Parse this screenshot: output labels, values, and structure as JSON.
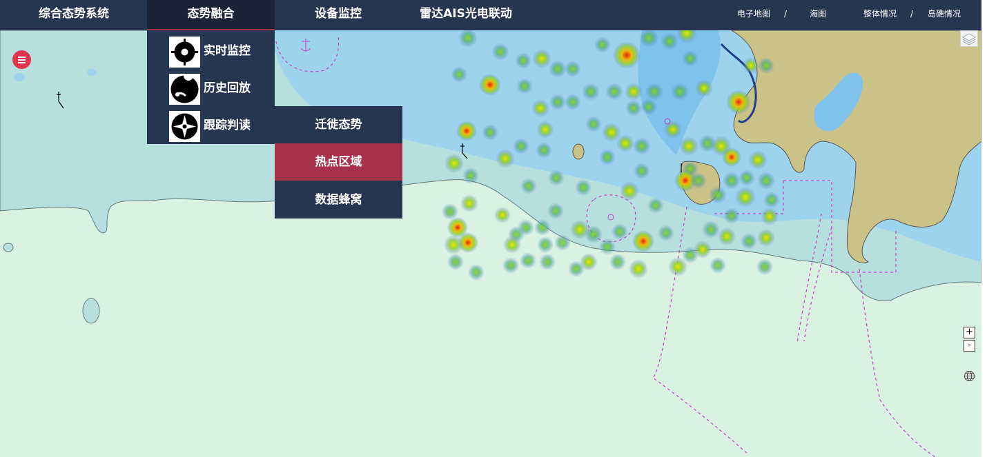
{
  "nav": {
    "brand": "综合态势系统",
    "items": [
      {
        "label": "态势融合"
      },
      {
        "label": "设备监控"
      },
      {
        "label": "雷达AIS光电联动"
      }
    ]
  },
  "right_links": {
    "link1": "电子地图",
    "sep1": "/",
    "link2": "海图",
    "link3": "整体情况",
    "sep2": "/",
    "link4": "岛礁情况"
  },
  "dropdown": {
    "items": [
      {
        "label": "实时监控",
        "icon": "crosshair-compass-icon"
      },
      {
        "label": "历史回放",
        "icon": "replay-map-pin-icon"
      },
      {
        "label": "跟踪判读",
        "icon": "compass-rose-icon"
      }
    ]
  },
  "submenu": {
    "items": [
      {
        "label": "迁徙态势"
      },
      {
        "label": "热点区域"
      },
      {
        "label": "数据蜂窝"
      }
    ],
    "active_index": 1
  },
  "map_controls": {
    "zoom_in": "+",
    "zoom_out": "-"
  },
  "colors": {
    "nav_bg": "#263550",
    "nav_active_bg": "#1a2436",
    "accent": "#a7304a",
    "menu_button": "#e0344e",
    "shallow_sea": "#9ed3ee",
    "deep_sea": "#b7dfdd",
    "open_sea": "#d9f2e3",
    "land": "#cbc287"
  }
}
